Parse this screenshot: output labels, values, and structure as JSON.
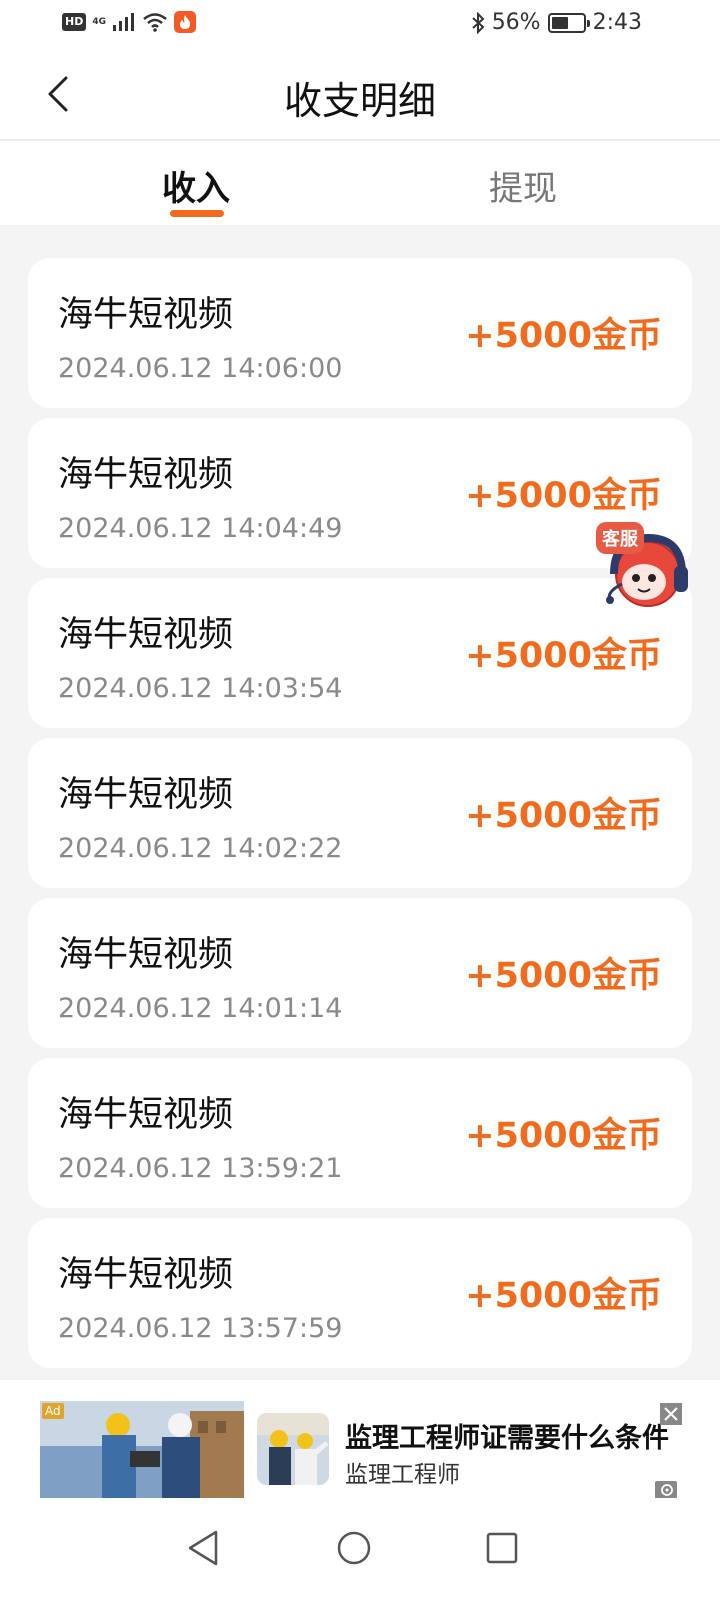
{
  "status_bar": {
    "hd": "HD",
    "network": "4G",
    "battery_percent": "56%",
    "battery_level": 0.56,
    "time": "2:43",
    "icons": [
      "signal-icon",
      "wifi-icon",
      "flame-app-icon",
      "bluetooth-icon",
      "battery-icon"
    ]
  },
  "header": {
    "title": "收支明细",
    "back_icon": "chevron-left-icon"
  },
  "tabs": [
    {
      "label": "收入",
      "active": true
    },
    {
      "label": "提现",
      "active": false
    }
  ],
  "records": [
    {
      "name": "海牛短视频",
      "time": "2024.06.12 14:06:00",
      "amount": "+5000金币"
    },
    {
      "name": "海牛短视频",
      "time": "2024.06.12 14:04:49",
      "amount": "+5000金币"
    },
    {
      "name": "海牛短视频",
      "time": "2024.06.12 14:03:54",
      "amount": "+5000金币"
    },
    {
      "name": "海牛短视频",
      "time": "2024.06.12 14:02:22",
      "amount": "+5000金币"
    },
    {
      "name": "海牛短视频",
      "time": "2024.06.12 14:01:14",
      "amount": "+5000金币"
    },
    {
      "name": "海牛短视频",
      "time": "2024.06.12 13:59:21",
      "amount": "+5000金币"
    },
    {
      "name": "海牛短视频",
      "time": "2024.06.12 13:57:59",
      "amount": "+5000金币"
    }
  ],
  "customer_service": {
    "label": "客服"
  },
  "ad": {
    "tag": "Ad",
    "title": "监理工程师证需要什么条件",
    "subtitle": "监理工程师"
  },
  "colors": {
    "accent": "#f26b1d",
    "background": "#f4f4f4",
    "card": "#ffffff",
    "muted_text": "#8a8a8a"
  }
}
